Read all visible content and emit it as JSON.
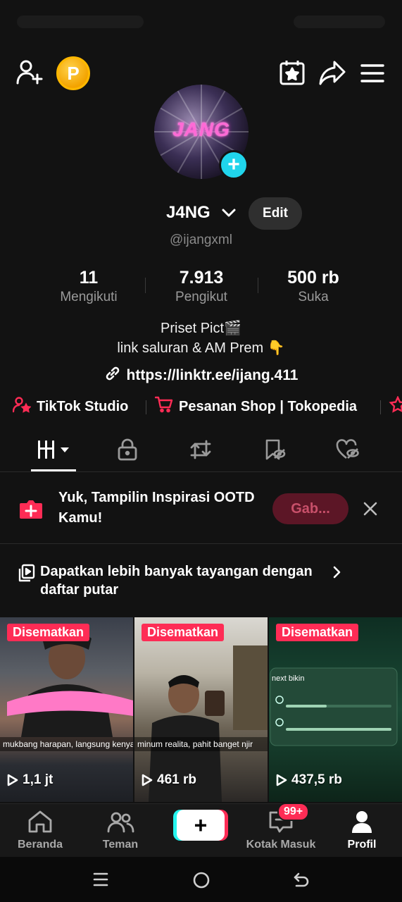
{
  "profile": {
    "display_name": "J4NG",
    "username": "@ijangxml",
    "edit_label": "Edit",
    "avatar_logo_text": "JANG",
    "stats": [
      {
        "value": "11",
        "label": "Mengikuti"
      },
      {
        "value": "7.913",
        "label": "Pengikut"
      },
      {
        "value": "500 rb",
        "label": "Suka"
      }
    ],
    "bio_line1": "Priset Pict🎬",
    "bio_line2": "link saluran & AM Prem 👇",
    "link": "https://linktr.ee/ijang.411"
  },
  "coin_letter": "P",
  "tools": [
    {
      "label": "TikTok Studio",
      "icon": "person-star-icon"
    },
    {
      "label": "Pesanan Shop | Tokopedia",
      "icon": "cart-icon"
    }
  ],
  "tabs": [
    {
      "name": "videos",
      "icon": "grid-icon",
      "active": true
    },
    {
      "name": "private",
      "icon": "lock-icon"
    },
    {
      "name": "reposts",
      "icon": "repost-icon"
    },
    {
      "name": "favorites",
      "icon": "bookmark-hidden-icon"
    },
    {
      "name": "liked",
      "icon": "heart-hidden-icon"
    }
  ],
  "promo": {
    "text": "Yuk, Tampilin Inspirasi OOTD Kamu!",
    "button": "Gab..."
  },
  "playlist": {
    "text": "Dapatkan lebih banyak tayangan dengan daftar putar"
  },
  "videos": [
    {
      "pinned_label": "Disematkan",
      "views": "1,1 jt",
      "caption": "mukbang harapan, langsung kenyang gw njir"
    },
    {
      "pinned_label": "Disematkan",
      "views": "461 rb",
      "caption": "minum realita, pahit banget njir"
    },
    {
      "pinned_label": "Disematkan",
      "views": "437,5 rb",
      "caption": "next bikin"
    }
  ],
  "nav": {
    "home": "Beranda",
    "friends": "Teman",
    "inbox": "Kotak Masuk",
    "inbox_badge": "99+",
    "profile": "Profil"
  },
  "colors": {
    "accent": "#fe2c55",
    "cyan": "#20d5ec",
    "background": "#121212"
  }
}
